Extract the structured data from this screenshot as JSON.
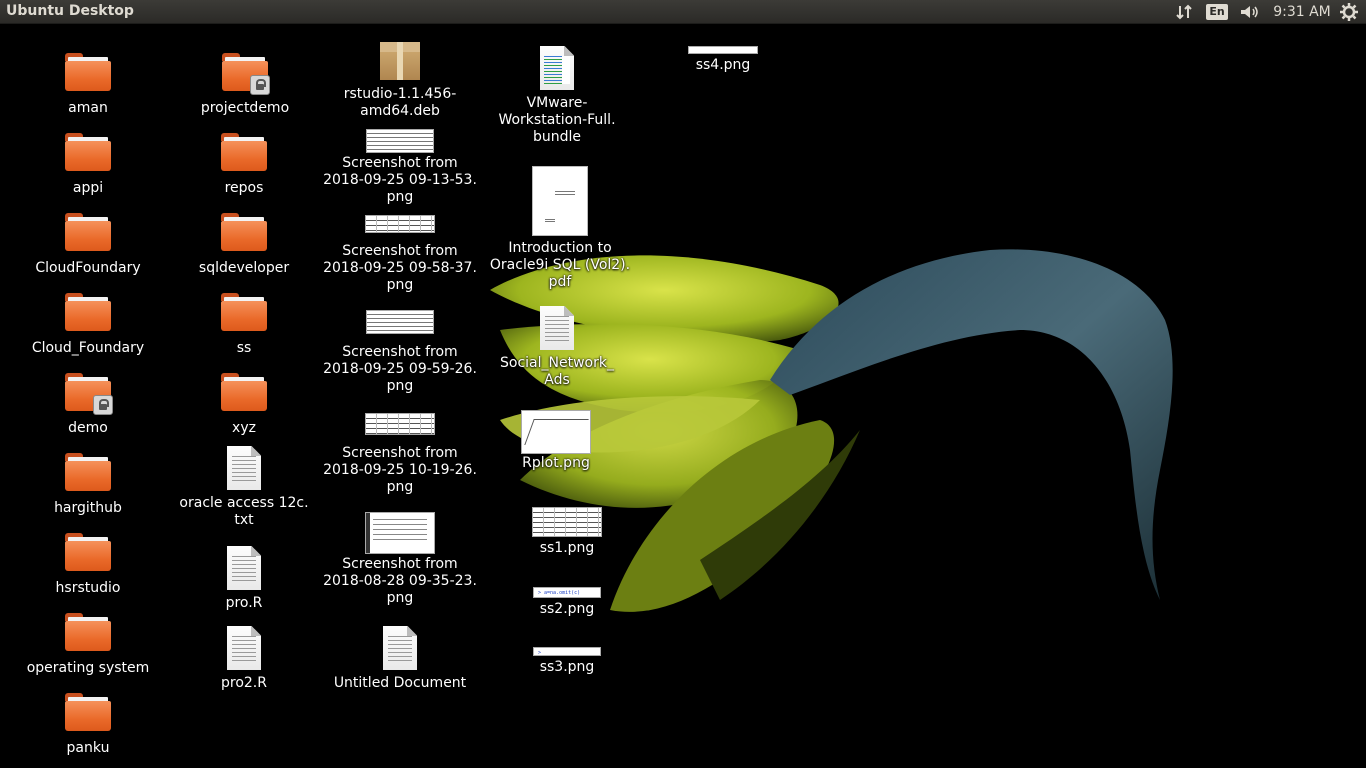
{
  "topbar": {
    "title": "Ubuntu Desktop",
    "language": "En",
    "clock": "9:31 AM"
  },
  "desktop": {
    "col1": {
      "aman": "aman",
      "appi": "appi",
      "cloudfoundary": "CloudFoundary",
      "cloud_foundary": "Cloud_Foundary",
      "demo": "demo",
      "hargithub": "hargithub",
      "hsrstudio": "hsrstudio",
      "operating_system": "operating system",
      "panku": "panku"
    },
    "col2": {
      "projectdemo": "projectdemo",
      "repos": "repos",
      "sqldeveloper": "sqldeveloper",
      "ss": "ss",
      "xyz": "xyz",
      "oracle_access_l1": "oracle access 12c.",
      "oracle_access_l2": "txt",
      "pro_r": "pro.R",
      "pro2_r": "pro2.R"
    },
    "col3": {
      "rstudio_l1": "rstudio-1.1.456-",
      "rstudio_l2": "amd64.deb",
      "ss1_l1": "Screenshot from",
      "ss1_l2": "2018-09-25 09-13-53.",
      "ss1_l3": "png",
      "ss2_l1": "Screenshot from",
      "ss2_l2": "2018-09-25 09-58-37.",
      "ss2_l3": "png",
      "ss3_l1": "Screenshot from",
      "ss3_l2": "2018-09-25 09-59-26.",
      "ss3_l3": "png",
      "ss4_l1": "Screenshot from",
      "ss4_l2": "2018-09-25 10-19-26.",
      "ss4_l3": "png",
      "ss5_l1": "Screenshot from",
      "ss5_l2": "2018-08-28 09-35-23.",
      "ss5_l3": "png",
      "untitled": "Untitled Document"
    },
    "col4": {
      "vmware_l1": "VMware-",
      "vmware_l2": "Workstation-Full.",
      "vmware_l3": "bundle",
      "pdf_l1": "Introduction to",
      "pdf_l2": "Oracle9i SQL (Vol2).",
      "pdf_l3": "pdf",
      "social_l1": "Social_Network_",
      "social_l2": "Ads",
      "rplot": "Rplot.png",
      "ss1png": "ss1.png",
      "ss2png": "ss2.png",
      "ss2_thumb_text": "> a=na.omit(c)",
      "ss3png": "ss3.png",
      "ss3_thumb_text": "> fit=kmeans(a[2:17],5)"
    },
    "col5": {
      "ss4png": "ss4.png"
    }
  }
}
